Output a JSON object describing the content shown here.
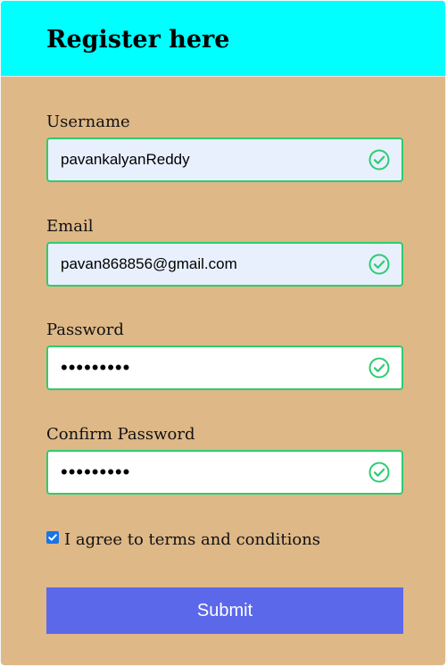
{
  "header": {
    "title": "Register here"
  },
  "form": {
    "fields": [
      {
        "label": "Username",
        "value": "pavankalyanReddy",
        "type": "text",
        "valid": true
      },
      {
        "label": "Email",
        "value": "pavan868856@gmail.com",
        "type": "email",
        "valid": true
      },
      {
        "label": "Password",
        "value": "•••••••••",
        "type": "password",
        "valid": true
      },
      {
        "label": "Confirm Password",
        "value": "•••••••••",
        "type": "password",
        "valid": true
      }
    ],
    "agree": {
      "label": "I agree to terms and conditions",
      "checked": true
    },
    "submit_label": "Submit"
  },
  "colors": {
    "header_bg": "#00ffff",
    "card_bg": "#deb887",
    "valid_border": "#2ecc71",
    "autofill_bg": "#e8f0fe",
    "submit_bg": "#5b68ea",
    "checkbox": "#1a73e8"
  },
  "icons": {
    "valid": "check-circle-icon",
    "checkbox": "checkmark-icon"
  }
}
